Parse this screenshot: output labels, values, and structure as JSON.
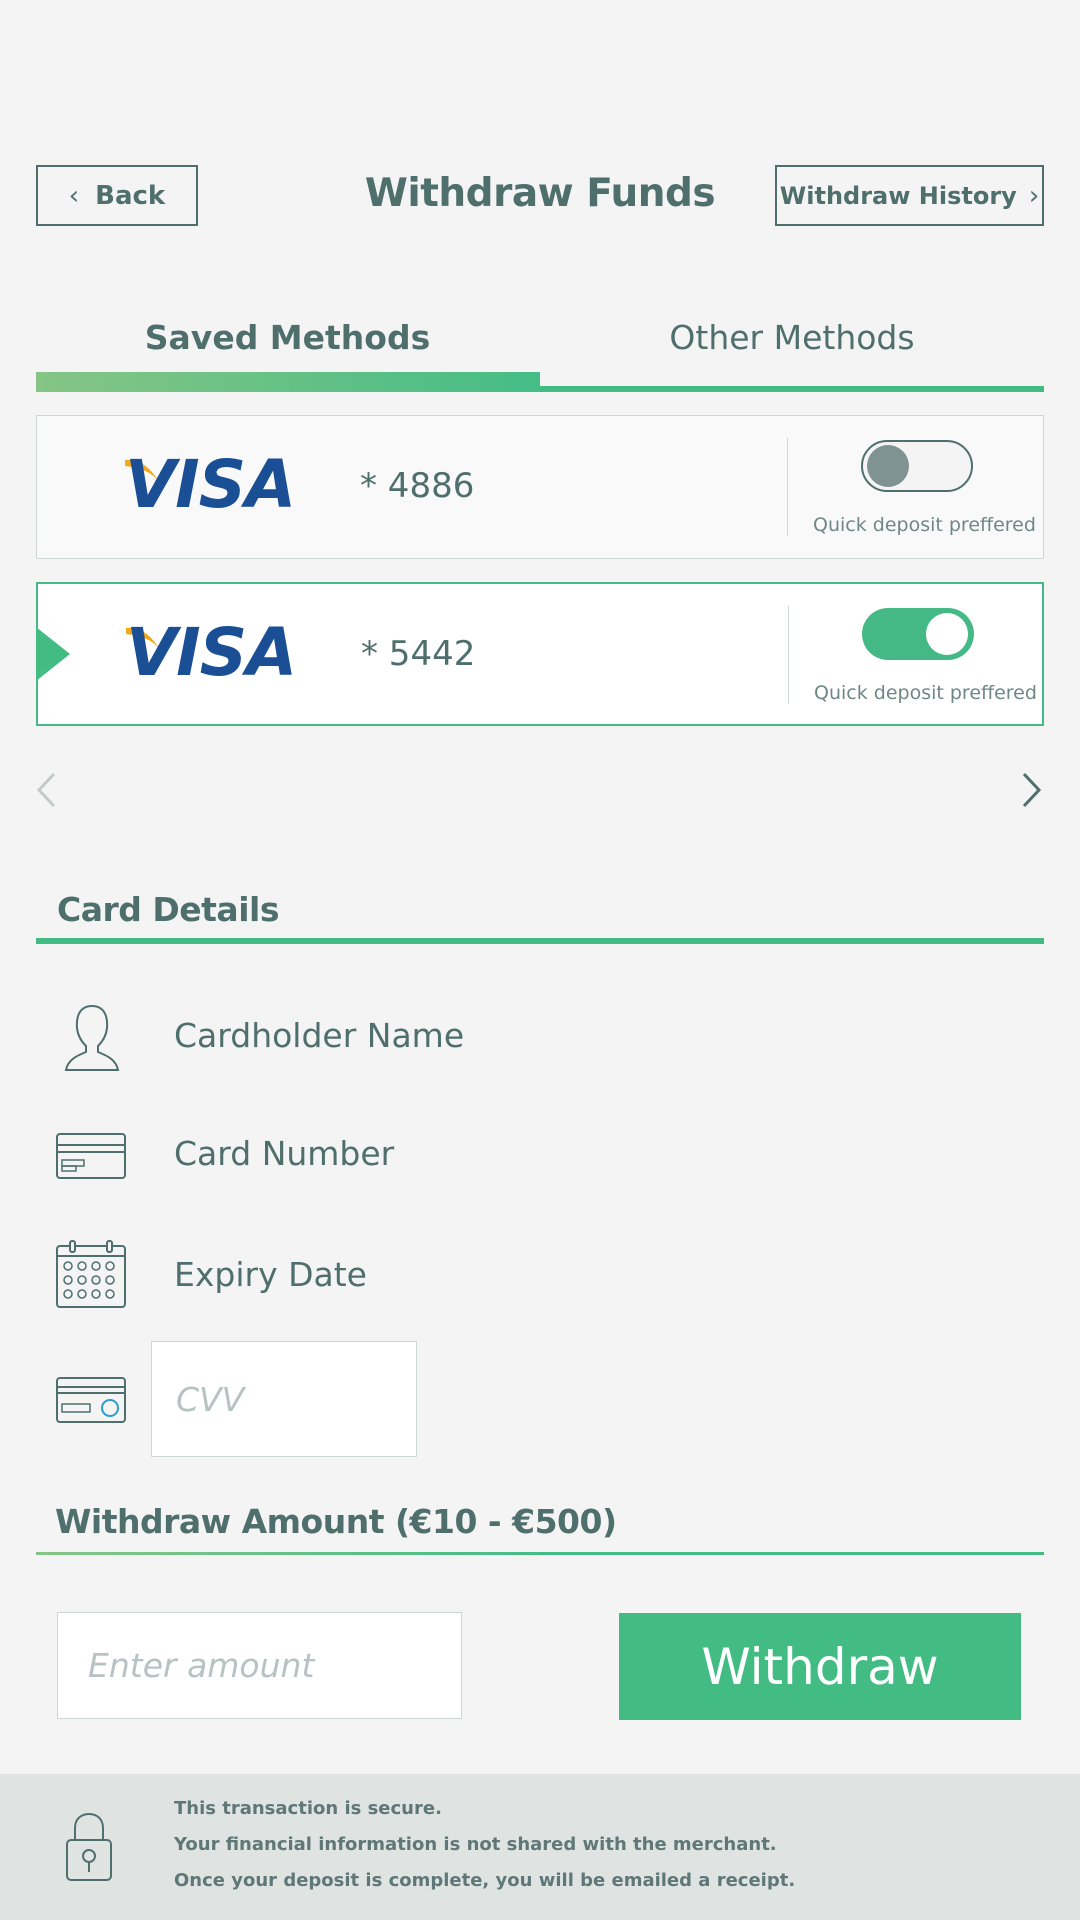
{
  "header": {
    "back_label": "Back",
    "title": "Withdraw Funds",
    "history_label": "Withdraw History"
  },
  "tabs": [
    {
      "label": "Saved Methods",
      "active": true
    },
    {
      "label": "Other Methods",
      "active": false
    }
  ],
  "saved_cards": [
    {
      "brand": "VISA",
      "number": "* 4886",
      "quick_deposit": false,
      "quick_label": "Quick deposit preffered"
    },
    {
      "brand": "VISA",
      "number": "* 5442",
      "quick_deposit": true,
      "quick_label": "Quick deposit preffered",
      "selected": true
    }
  ],
  "card_details": {
    "heading": "Card Details",
    "cardholder_label": "Cardholder Name",
    "card_number_label": "Card Number",
    "expiry_label": "Expiry Date",
    "cvv_placeholder": "CVV"
  },
  "amount": {
    "heading": "Withdraw Amount (€10 - €500)",
    "placeholder": "Enter amount",
    "submit_label": "Withdraw"
  },
  "footer": {
    "line1": "This transaction is secure.",
    "line2": "Your financial information is not shared with the merchant.",
    "line3": "Once your deposit is complete, you will be emailed a receipt."
  },
  "colors": {
    "accent": "#42bc83",
    "text": "#4f6f6d",
    "visa_blue": "#1a4f96",
    "visa_gold": "#f2a81d"
  }
}
